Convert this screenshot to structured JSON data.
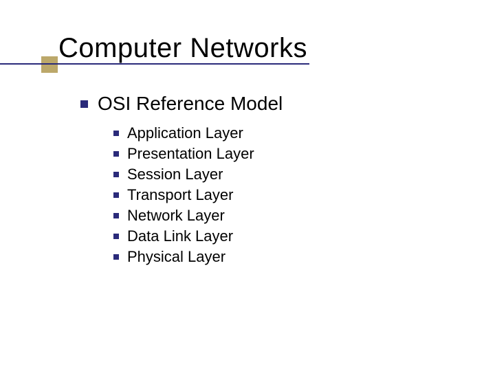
{
  "title": "Computer Networks",
  "level1": "OSI Reference Model",
  "layers": {
    "l0": "Application Layer",
    "l1": "Presentation Layer",
    "l2": "Session Layer",
    "l3": "Transport Layer",
    "l4": "Network Layer",
    "l5": "Data Link Layer",
    "l6": "Physical Layer"
  }
}
